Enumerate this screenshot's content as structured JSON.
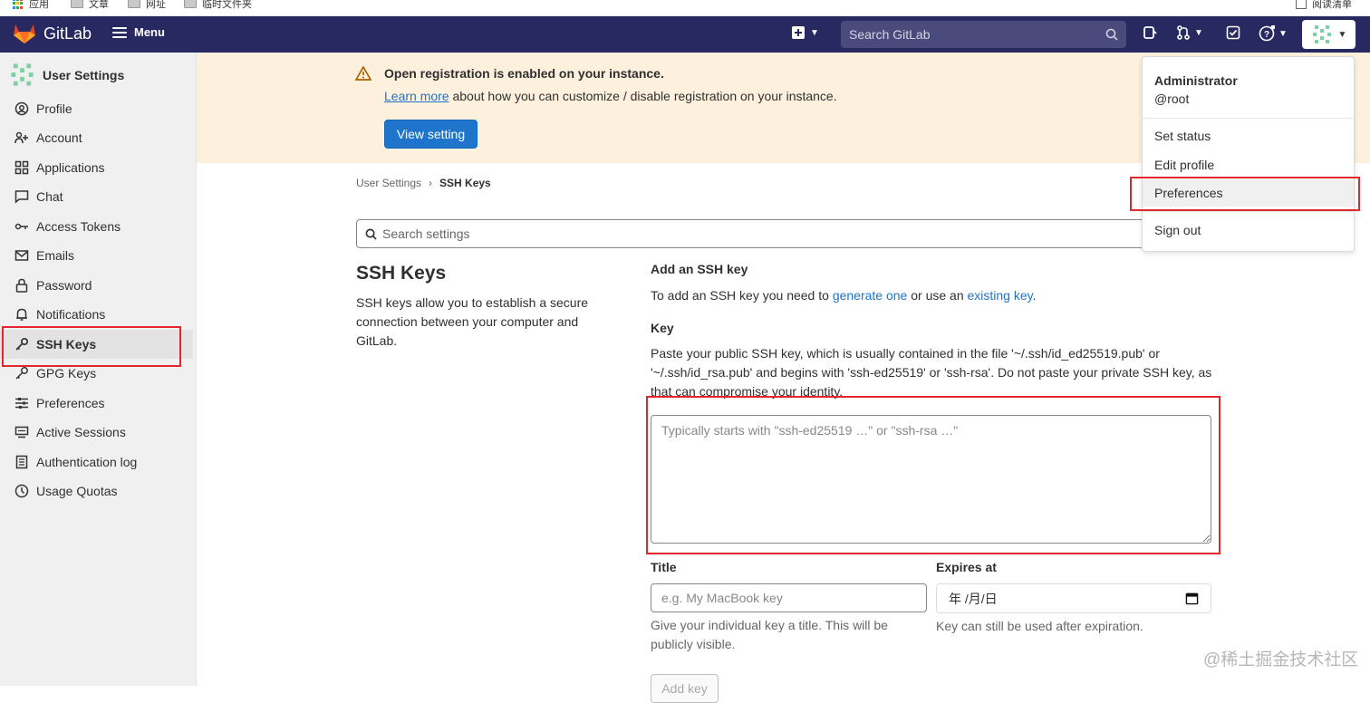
{
  "bookmarks": {
    "items": [
      {
        "label": "应用"
      },
      {
        "label": "文章"
      },
      {
        "label": "网址"
      },
      {
        "label": "临时文件夹"
      }
    ],
    "reading_list": "阅读清单"
  },
  "topbar": {
    "brand": "GitLab",
    "menu_label": "Menu",
    "search_placeholder": "Search GitLab"
  },
  "sidebar": {
    "title": "User Settings",
    "items": [
      {
        "label": "Profile",
        "icon": "profile-icon"
      },
      {
        "label": "Account",
        "icon": "account-icon"
      },
      {
        "label": "Applications",
        "icon": "applications-icon"
      },
      {
        "label": "Chat",
        "icon": "chat-icon"
      },
      {
        "label": "Access Tokens",
        "icon": "token-icon"
      },
      {
        "label": "Emails",
        "icon": "mail-icon"
      },
      {
        "label": "Password",
        "icon": "lock-icon"
      },
      {
        "label": "Notifications",
        "icon": "bell-icon"
      },
      {
        "label": "SSH Keys",
        "icon": "key-icon",
        "active": true
      },
      {
        "label": "GPG Keys",
        "icon": "key-icon"
      },
      {
        "label": "Preferences",
        "icon": "preferences-icon"
      },
      {
        "label": "Active Sessions",
        "icon": "monitor-icon"
      },
      {
        "label": "Authentication log",
        "icon": "log-icon"
      },
      {
        "label": "Usage Quotas",
        "icon": "quota-icon"
      }
    ]
  },
  "banner": {
    "title": "Open registration is enabled on your instance.",
    "link": "Learn more",
    "text": " about how you can customize / disable registration on your instance.",
    "button": "View setting"
  },
  "breadcrumb": {
    "parent": "User Settings",
    "separator": "›",
    "current": "SSH Keys"
  },
  "settings_search": {
    "placeholder": "Search settings"
  },
  "section": {
    "title": "SSH Keys",
    "description": "SSH keys allow you to establish a secure connection between your computer and GitLab."
  },
  "form": {
    "add_title": "Add an SSH key",
    "add_desc_prefix": "To add an SSH key you need to ",
    "add_desc_link1": "generate one",
    "add_desc_middle": " or use an ",
    "add_desc_link2": "existing key",
    "add_desc_suffix": ".",
    "key_label": "Key",
    "key_help": "Paste your public SSH key, which is usually contained in the file '~/.ssh/id_ed25519.pub' or '~/.ssh/id_rsa.pub' and begins with 'ssh-ed25519' or 'ssh-rsa'. Do not paste your private SSH key, as that can compromise your identity.",
    "key_placeholder": "Typically starts with \"ssh-ed25519 …\" or \"ssh-rsa …\"",
    "title_label": "Title",
    "title_placeholder": "e.g. My MacBook key",
    "title_help": "Give your individual key a title. This will be publicly visible.",
    "expires_label": "Expires at",
    "expires_value": "年 /月/日",
    "expires_help": "Key can still be used after expiration.",
    "submit": "Add key"
  },
  "dropdown": {
    "name": "Administrator",
    "username": "@root",
    "items": [
      {
        "label": "Set status"
      },
      {
        "label": "Edit profile"
      },
      {
        "label": "Preferences"
      },
      {
        "label": "Sign out"
      }
    ]
  },
  "watermark": "@稀土掘金技术社区",
  "colors": {
    "topbar": "#292961",
    "accent": "#1f75cb",
    "highlight_box": "#e3262b",
    "banner": "#fdf1dd"
  }
}
